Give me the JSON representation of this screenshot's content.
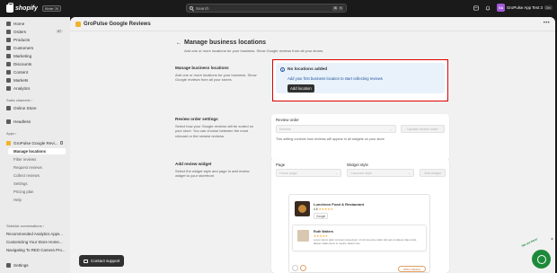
{
  "topbar": {
    "logo_text": "shopify",
    "badge": "Winter '26",
    "search_placeholder": "Search",
    "shortcut_keys": [
      "⌘",
      "K"
    ],
    "store_initials": "GA",
    "store_name": "GroPulse App Test 3",
    "store_tag": "Dev"
  },
  "sidebar": {
    "items": [
      {
        "label": "Home"
      },
      {
        "label": "Orders",
        "count": "87"
      },
      {
        "label": "Products"
      },
      {
        "label": "Customers"
      },
      {
        "label": "Marketing"
      },
      {
        "label": "Discounts"
      },
      {
        "label": "Content"
      },
      {
        "label": "Markets"
      },
      {
        "label": "Analytics"
      }
    ],
    "sales_channels_label": "Sales channels",
    "online_store": "Online Store",
    "headless": "Headless",
    "apps_label": "Apps",
    "app_name": "GroPulse Google Revi...",
    "sub_items": [
      "Manage locations",
      "Filter reviews",
      "Request reviews",
      "Collect reviews",
      "Settings",
      "Pricing plan",
      "Help"
    ],
    "conversations_label": "Sidekick conversations",
    "conversations": [
      "Recommended Analytics Apps...",
      "Customizing Your Store Home...",
      "Navigating To RED Camera Pro..."
    ],
    "settings": "Settings"
  },
  "app_header": {
    "title": "GroPulse Google Reviews"
  },
  "page": {
    "title": "Manage business locations",
    "subtitle": "Add one or more locations for your business. Show Google reviews from all your stores."
  },
  "section_locations": {
    "title": "Manage business locations",
    "desc": "Add one or more locations for your business. Show Google reviews from all your stores.",
    "banner_title": "No locations added",
    "banner_text": "Add your first business location to start collecting reviews",
    "button": "Add location"
  },
  "section_order": {
    "title": "Review order settings",
    "desc": "Select how your Google reviews will be sorted on your store. You can choose between the most relevant or the newest reviews.",
    "label": "Review order",
    "select_value": "Newest",
    "button": "Update review order",
    "help": "This setting controls how reviews will appear in all widgets on your store"
  },
  "section_widget": {
    "title": "Add review widget",
    "desc": "Select the widget style and page to add review widget to your storefront",
    "page_label": "Page",
    "page_value": "Home page",
    "style_label": "Widget style",
    "style_value": "Carousel style",
    "button": "Add widget"
  },
  "preview": {
    "business_name": "Luncheon Food & Restaurant",
    "rating": "4.6",
    "stars": "★★★★★",
    "source": "Google",
    "reviewer": "Ruth Walters",
    "review_stars": "★★★★★",
    "review_text": "Lorem ipsum dolor sit amet consectetur. Ut sit nisi porta mattis nisl quis ut aliquet vitae turpis aliquet mattis lorem in mauris. Read more",
    "write_button": "Write A Review"
  },
  "support": {
    "contact_button": "Contact support",
    "bubble_text": "We are here!"
  }
}
